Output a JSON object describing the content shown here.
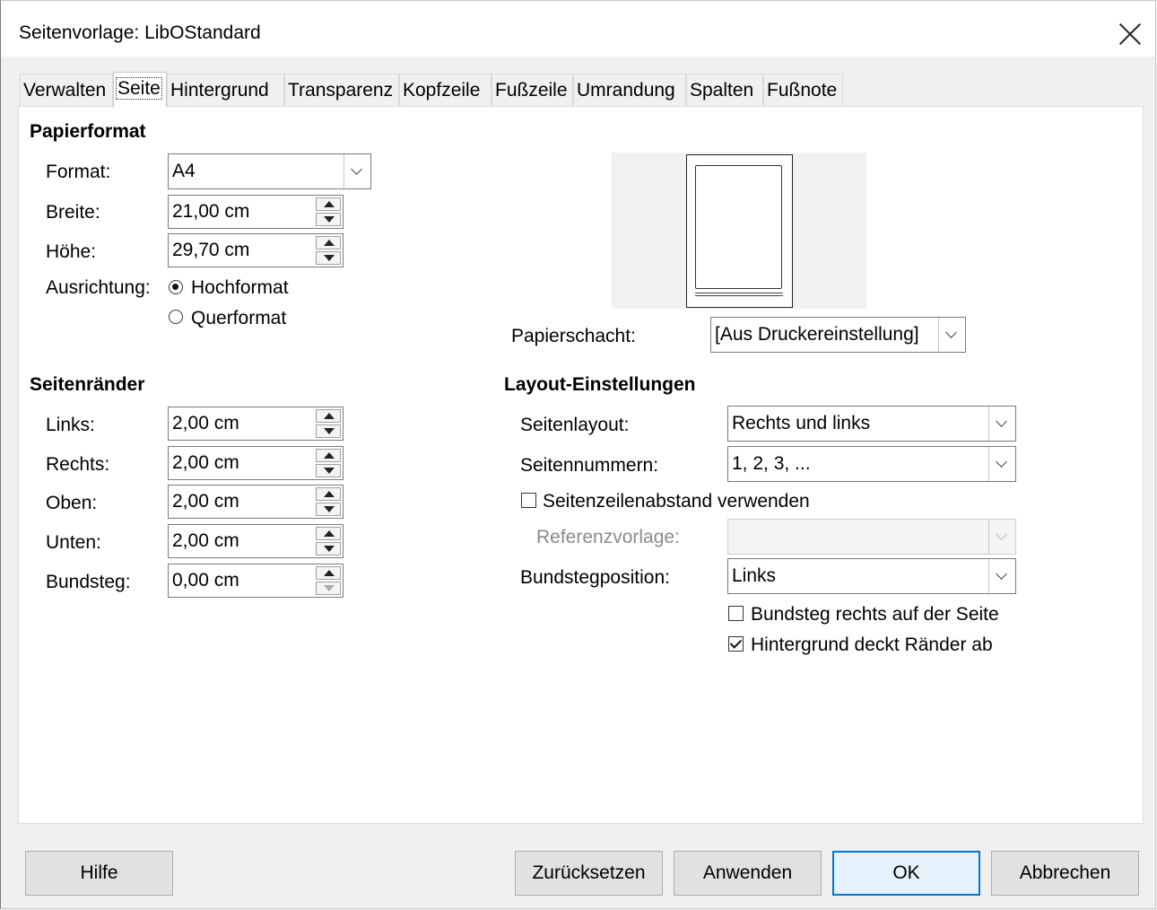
{
  "window": {
    "title": "Seitenvorlage: LibOStandard"
  },
  "tabs": [
    "Verwalten",
    "Seite",
    "Hintergrund",
    "Transparenz",
    "Kopfzeile",
    "Fußzeile",
    "Umrandung",
    "Spalten",
    "Fußnote"
  ],
  "active_tab": "Seite",
  "paper_format": {
    "heading": "Papierformat",
    "format_label": "Format:",
    "format_value": "A4",
    "width_label": "Breite:",
    "width_value": "21,00 cm",
    "height_label": "Höhe:",
    "height_value": "29,70 cm",
    "orientation_label": "Ausrichtung:",
    "portrait_label": "Hochformat",
    "landscape_label": "Querformat",
    "orientation_selected": "Hochformat"
  },
  "paper_tray": {
    "label": "Papierschacht:",
    "value": "[Aus Druckereinstellung]"
  },
  "margins": {
    "heading": "Seitenränder",
    "left_label": "Links:",
    "left_value": "2,00 cm",
    "right_label": "Rechts:",
    "right_value": "2,00 cm",
    "top_label": "Oben:",
    "top_value": "2,00 cm",
    "bottom_label": "Unten:",
    "bottom_value": "2,00 cm",
    "gutter_label": "Bundsteg:",
    "gutter_value": "0,00 cm"
  },
  "layout": {
    "heading": "Layout-Einstellungen",
    "page_layout_label": "Seitenlayout:",
    "page_layout_value": "Rechts und links",
    "page_numbers_label": "Seitennummern:",
    "page_numbers_value": "1, 2, 3, ...",
    "register_true_label": "Seitenzeilenabstand verwenden",
    "register_true_checked": false,
    "reference_style_label": "Referenzvorlage:",
    "reference_style_value": "",
    "gutter_position_label": "Bundstegposition:",
    "gutter_position_value": "Links",
    "gutter_right_label": "Bundsteg rechts auf der Seite",
    "gutter_right_checked": false,
    "background_covers_label": "Hintergrund deckt Ränder ab",
    "background_covers_checked": true
  },
  "buttons": {
    "help": "Hilfe",
    "reset": "Zurücksetzen",
    "apply": "Anwenden",
    "ok": "OK",
    "cancel": "Abbrechen"
  },
  "colors": {
    "default_button_border": "#0078d7",
    "panel_bg": "#ffffff",
    "dialog_bg": "#f0f0f0"
  }
}
